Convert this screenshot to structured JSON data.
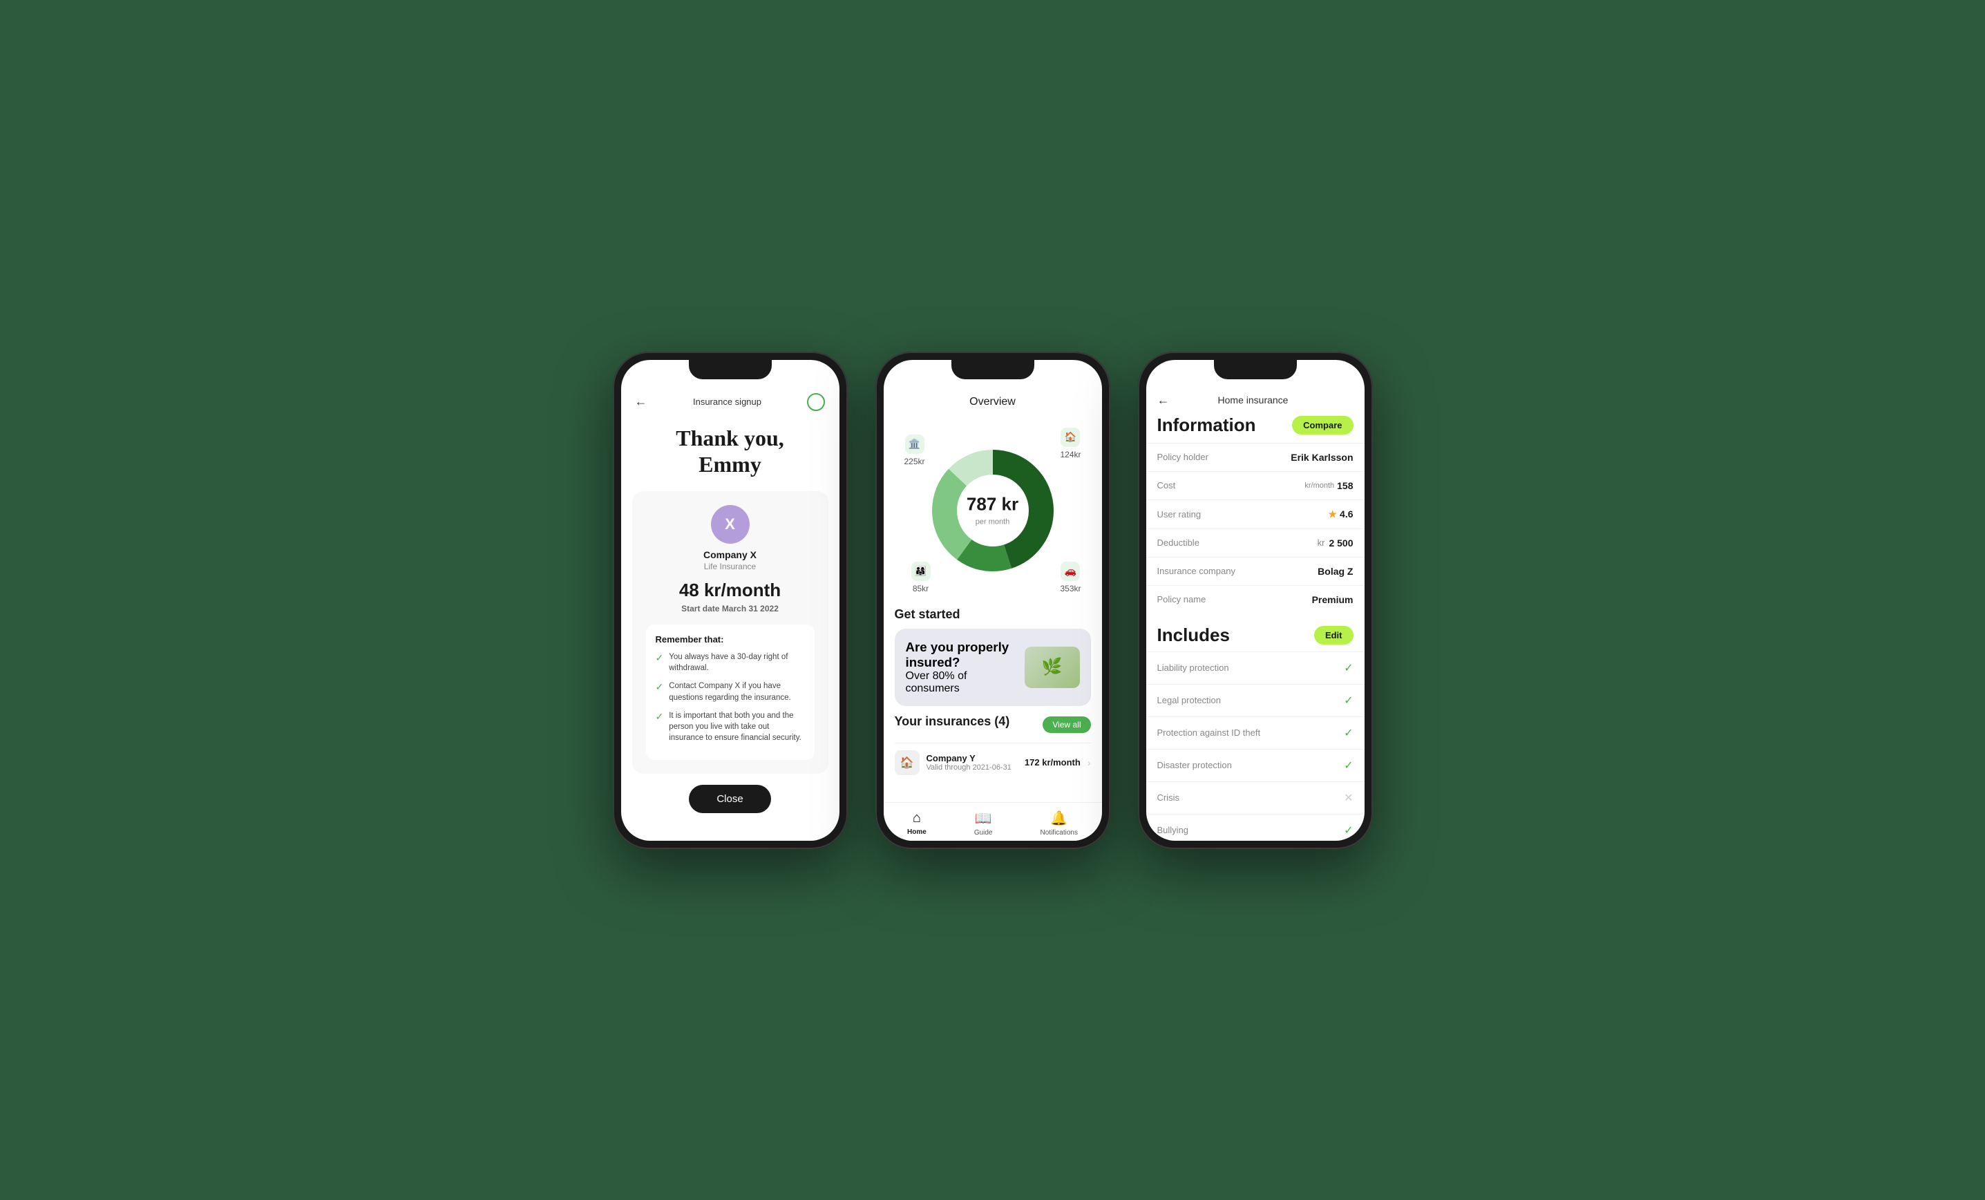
{
  "background_color": "#2d5a3d",
  "phone1": {
    "header": {
      "title": "Insurance signup",
      "back_label": "←",
      "circle_label": "○"
    },
    "main_title": "Thank you,\nEmmy",
    "company": {
      "avatar_letter": "X",
      "name": "Company X",
      "type": "Life Insurance"
    },
    "price": "48 kr/month",
    "start_date_label": "Start date",
    "start_date_value": "March 31 2022",
    "remember_title": "Remember that:",
    "checklist": [
      "You always have a 30-day right of withdrawal.",
      "Contact Company X  if you have questions regarding the insurance.",
      "It is important that both you and the person you live with take out insurance to ensure financial security."
    ],
    "close_button": "Close"
  },
  "phone2": {
    "header_title": "Overview",
    "center_amount": "787 kr",
    "center_label": "per month",
    "labels": [
      {
        "amount": "225kr",
        "icon": "🏛️",
        "position": "tl"
      },
      {
        "amount": "124kr",
        "icon": "🏠",
        "position": "tr"
      },
      {
        "amount": "85kr",
        "icon": "👨‍👩‍👧",
        "position": "bl"
      },
      {
        "amount": "353kr",
        "icon": "🚗",
        "position": "br"
      }
    ],
    "get_started_title": "Get started",
    "promo_title": "Are you properly insured?",
    "promo_subtitle": "Over 80% of consumers",
    "insurances_title": "Your insurances (4)",
    "view_all_label": "View all",
    "insurance_item": {
      "name": "Company Y",
      "valid": "Valid through 2021-06-31",
      "price": "172 kr/month",
      "type": "Home insurance"
    },
    "nav": [
      {
        "icon": "⌂",
        "label": "Home",
        "active": true
      },
      {
        "icon": "📖",
        "label": "Guide",
        "active": false
      },
      {
        "icon": "🔔",
        "label": "Notifications",
        "active": false
      }
    ],
    "donut": {
      "segments": [
        {
          "color": "#1b5e20",
          "pct": 0.45
        },
        {
          "color": "#388e3c",
          "pct": 0.15
        },
        {
          "color": "#81c784",
          "pct": 0.27
        },
        {
          "color": "#c8e6c9",
          "pct": 0.13
        }
      ]
    }
  },
  "phone3": {
    "header_title": "Home insurance",
    "back_label": "←",
    "info_section_title": "Information",
    "compare_label": "Compare",
    "fields": [
      {
        "label": "Policy holder",
        "value": "Erik Karlsson"
      },
      {
        "label": "Cost",
        "value": "158",
        "prefix": "kr/month"
      },
      {
        "label": "User rating",
        "value": "4.6",
        "star": true
      },
      {
        "label": "Deductible",
        "value": "2 500",
        "prefix": "kr"
      },
      {
        "label": "Insurance company",
        "value": "Bolag Z"
      },
      {
        "label": "Policy name",
        "value": "Premium"
      }
    ],
    "includes_title": "Includes",
    "edit_label": "Edit",
    "features": [
      {
        "label": "Liability protection",
        "included": true
      },
      {
        "label": "Legal protection",
        "included": true
      },
      {
        "label": "Protection against ID theft",
        "included": true
      },
      {
        "label": "Disaster protection",
        "included": true
      },
      {
        "label": "Crisis",
        "included": false
      },
      {
        "label": "Bullying",
        "included": true
      }
    ],
    "user_rating_badge": "User 4.6 rating"
  }
}
